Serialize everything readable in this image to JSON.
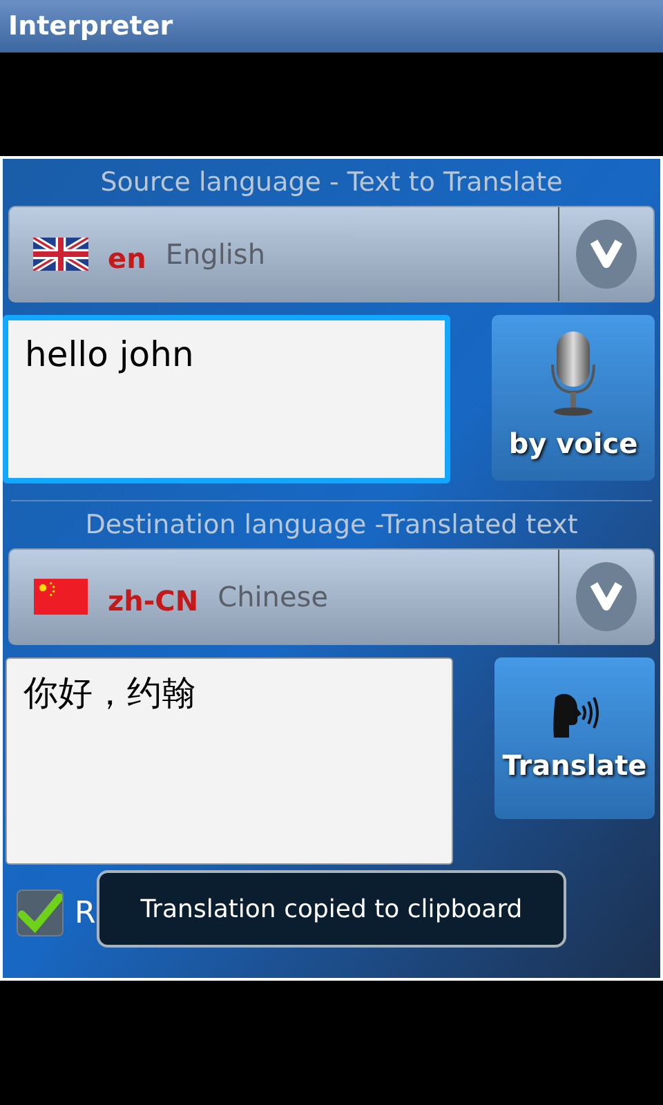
{
  "app_bar": {
    "title": "Interpreter"
  },
  "source": {
    "heading": "Source language - Text to Translate",
    "language": {
      "code": "en",
      "name": "English"
    },
    "text": "hello john",
    "focused": true,
    "button": "by voice"
  },
  "destination": {
    "heading": "Destination language -Translated text",
    "language": {
      "code": "zh-CN",
      "name": "Chinese"
    },
    "text": "你好，约翰",
    "focused": false,
    "button": "Translate"
  },
  "read_aloud": {
    "label": "R",
    "checked": true
  },
  "toast": {
    "text": "Translation copied to clipboard"
  }
}
